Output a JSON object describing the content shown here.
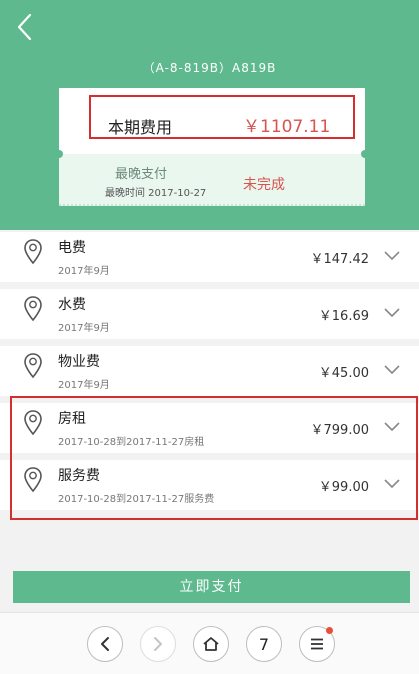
{
  "header": {
    "room_code": "（A-8-819B）A819B"
  },
  "summary": {
    "fee_label": "本期费用",
    "fee_amount": "￥1107.11",
    "deadline_label": "最晚支付",
    "deadline_date": "最晚时间 2017-10-27",
    "status": "未完成"
  },
  "items": [
    {
      "name": "电费",
      "sub": "2017年9月",
      "amount": "￥147.42"
    },
    {
      "name": "水费",
      "sub": "2017年9月",
      "amount": "￥16.69"
    },
    {
      "name": "物业费",
      "sub": "2017年9月",
      "amount": "￥45.00"
    },
    {
      "name": "房租",
      "sub": "2017-10-28到2017-11-27房租",
      "amount": "￥799.00"
    },
    {
      "name": "服务费",
      "sub": "2017-10-28到2017-11-27服务费",
      "amount": "￥99.00"
    }
  ],
  "pay_button": {
    "label": "立即支付"
  },
  "navbar": {
    "tab_count": "7"
  },
  "colors": {
    "accent": "#5fb98e",
    "alert": "#d9534f",
    "highlight_border": "#d32f2f"
  },
  "icons": [
    "chevron-left-icon",
    "location-pin-icon",
    "chevron-down-icon",
    "arrow-left-icon",
    "arrow-right-icon",
    "home-icon",
    "menu-icon"
  ]
}
